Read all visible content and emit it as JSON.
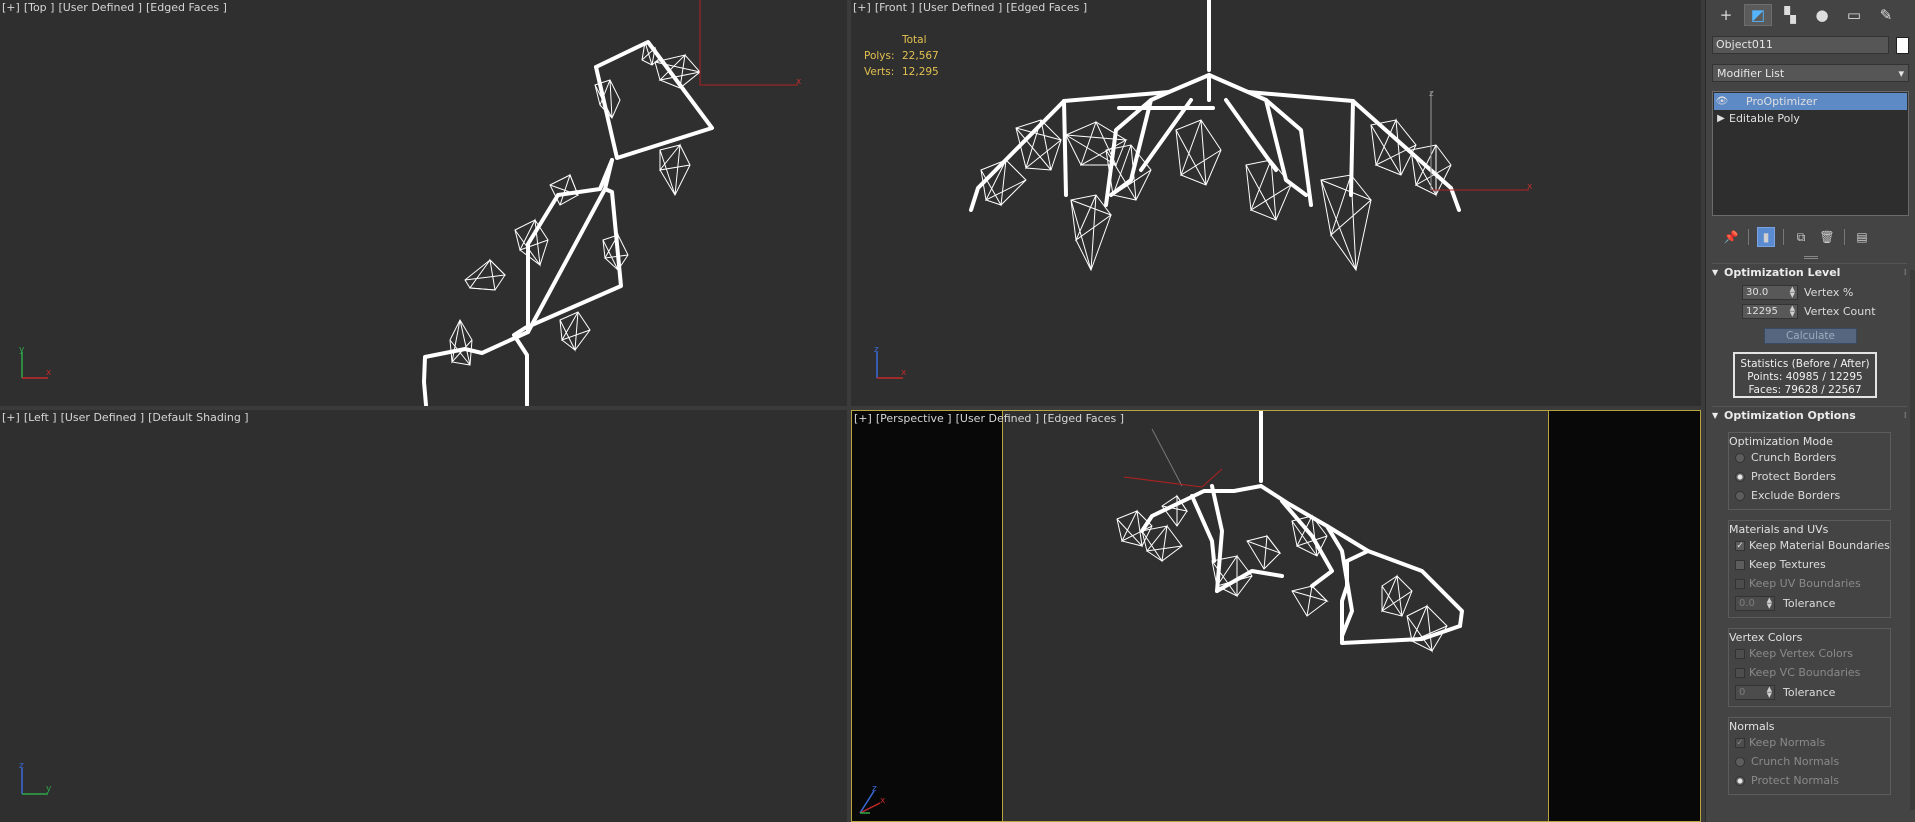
{
  "viewports": {
    "top": {
      "labels": [
        "[+]",
        "[Top ]",
        "[User Defined ]",
        "[Edged Faces ]"
      ]
    },
    "front": {
      "labels": [
        "[+]",
        "[Front ]",
        "[User Defined ]",
        "[Edged Faces ]"
      ]
    },
    "left": {
      "labels": [
        "[+]",
        "[Left ]",
        "[User Defined ]",
        "[Default Shading ]"
      ]
    },
    "perspective": {
      "labels": [
        "[+]",
        "[Perspective ]",
        "[User Defined ]",
        "[Edged Faces ]"
      ]
    }
  },
  "statistics_overlay": {
    "header": "Total",
    "polys_label": "Polys:",
    "polys_value": "22,567",
    "verts_label": "Verts:",
    "verts_value": "12,295"
  },
  "axis_labels": {
    "x": "x",
    "y": "y",
    "z": "z"
  },
  "panel": {
    "tabs": [
      {
        "name": "create",
        "icon": "plus-icon",
        "glyph": "+"
      },
      {
        "name": "modify",
        "icon": "modify-icon",
        "glyph": "◩",
        "active": true
      },
      {
        "name": "hierarchy",
        "icon": "hierarchy-icon",
        "glyph": "▚"
      },
      {
        "name": "motion",
        "icon": "motion-icon",
        "glyph": "●"
      },
      {
        "name": "display",
        "icon": "display-icon",
        "glyph": "▭"
      },
      {
        "name": "utilities",
        "icon": "wrench-icon",
        "glyph": "✎"
      }
    ],
    "object_name": "Object011",
    "object_color": "#ffffff",
    "modifier_list_label": "Modifier List",
    "stack": [
      {
        "label": "ProOptimizer",
        "selected": true
      },
      {
        "label": "Editable Poly",
        "selected": false
      }
    ],
    "optimization_level": {
      "title": "Optimization Level",
      "vertex_percent_value": "30.0",
      "vertex_percent_label": "Vertex %",
      "vertex_count_value": "12295",
      "vertex_count_label": "Vertex Count",
      "calculate_label": "Calculate",
      "stats_title": "Statistics (Before / After)",
      "stats_points": "Points: 40985 / 12295",
      "stats_faces": "Faces: 79628 / 22567"
    },
    "optimization_options": {
      "title": "Optimization Options",
      "mode_group": "Optimization Mode",
      "modes": [
        {
          "label": "Crunch Borders",
          "on": false
        },
        {
          "label": "Protect Borders",
          "on": true
        },
        {
          "label": "Exclude Borders",
          "on": false
        }
      ],
      "materials_group": "Materials and UVs",
      "keep_material_boundaries": "Keep Material Boundaries",
      "keep_textures": "Keep Textures",
      "keep_uv_boundaries": "Keep UV Boundaries",
      "uv_tolerance_value": "0.0",
      "tolerance_label": "Tolerance",
      "vertex_colors_group": "Vertex Colors",
      "keep_vertex_colors": "Keep Vertex Colors",
      "keep_vc_boundaries": "Keep VC Boundaries",
      "vc_tolerance_value": "0",
      "normals_group": "Normals",
      "keep_normals": "Keep Normals",
      "crunch_normals": "Crunch Normals",
      "protect_normals": "Protect Normals"
    }
  }
}
